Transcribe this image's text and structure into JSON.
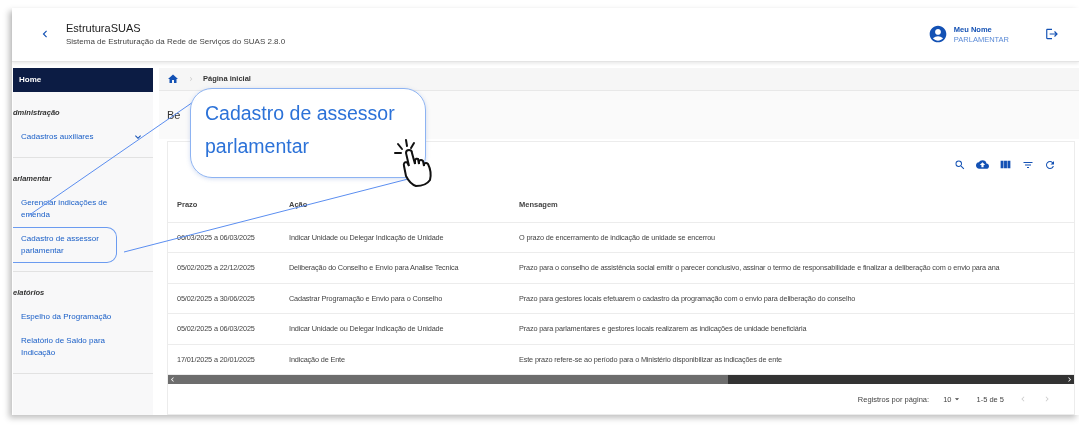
{
  "header": {
    "title": "EstruturaSUAS",
    "subtitle": "Sistema de Estruturação da Rede de Serviços do SUAS 2.8.0",
    "user": {
      "name": "Meu Nome",
      "role": "PARLAMENTAR"
    }
  },
  "sidebar": {
    "home": {
      "label": "Home",
      "selected": true
    },
    "sections": [
      {
        "title": "dministração",
        "items": [
          {
            "label": "Cadastros auxiliares",
            "kind": "dropdown",
            "highlighted": false
          }
        ]
      },
      {
        "title": "arlamentar",
        "items": [
          {
            "label": "Gerenciar indicações de emenda",
            "kind": "link",
            "highlighted": false
          },
          {
            "label": "Cadastro de assessor parlamentar",
            "kind": "link",
            "highlighted": true
          }
        ]
      },
      {
        "title": "elatórios",
        "items": [
          {
            "label": "Espelho da Programação",
            "kind": "link",
            "highlighted": false
          },
          {
            "label": "Relatório de Saldo para Indicação",
            "kind": "link",
            "highlighted": false
          }
        ]
      }
    ]
  },
  "breadcrumb": {
    "label": "Página inicial"
  },
  "page_title": "Be",
  "callout": {
    "text": "Cadastro de assessor parlamentar"
  },
  "table": {
    "columns": [
      "Prazo",
      "Ação",
      "Mensagem"
    ],
    "rows": [
      [
        "06/03/2025 a 06/03/2025",
        "Indicar Unidade ou Delegar Indicação de Unidade",
        "O prazo de encerramento de indicação de unidade se encerrou"
      ],
      [
        "05/02/2025 a 22/12/2025",
        "Deliberação do Conselho e Envio para Analise Tecnica",
        "Prazo para o conselho de assistência social emitir o parecer conclusivo, assinar o termo de responsabilidade e finalizar a deliberação com o envio para ana"
      ],
      [
        "05/02/2025 a 30/06/2025",
        "Cadastrar Programação e Envio para o Conselho",
        "Prazo para gestores locais efetuarem o cadastro da programação com o envio para deliberação do conselho"
      ],
      [
        "05/02/2025 a 06/03/2025",
        "Indicar Unidade ou Delegar Indicação de Unidade",
        "Prazo para parlamentares e gestores locais realizarem as indicações de unidade beneficiária"
      ],
      [
        "17/01/2025 a 20/01/2025",
        "Indicação de Ente",
        "Este prazo refere-se ao período para o Ministério disponibilizar as indicações de ente"
      ]
    ]
  },
  "pagination": {
    "label": "Registros por página:",
    "per_page": "10",
    "range": "1-5 de 5"
  }
}
